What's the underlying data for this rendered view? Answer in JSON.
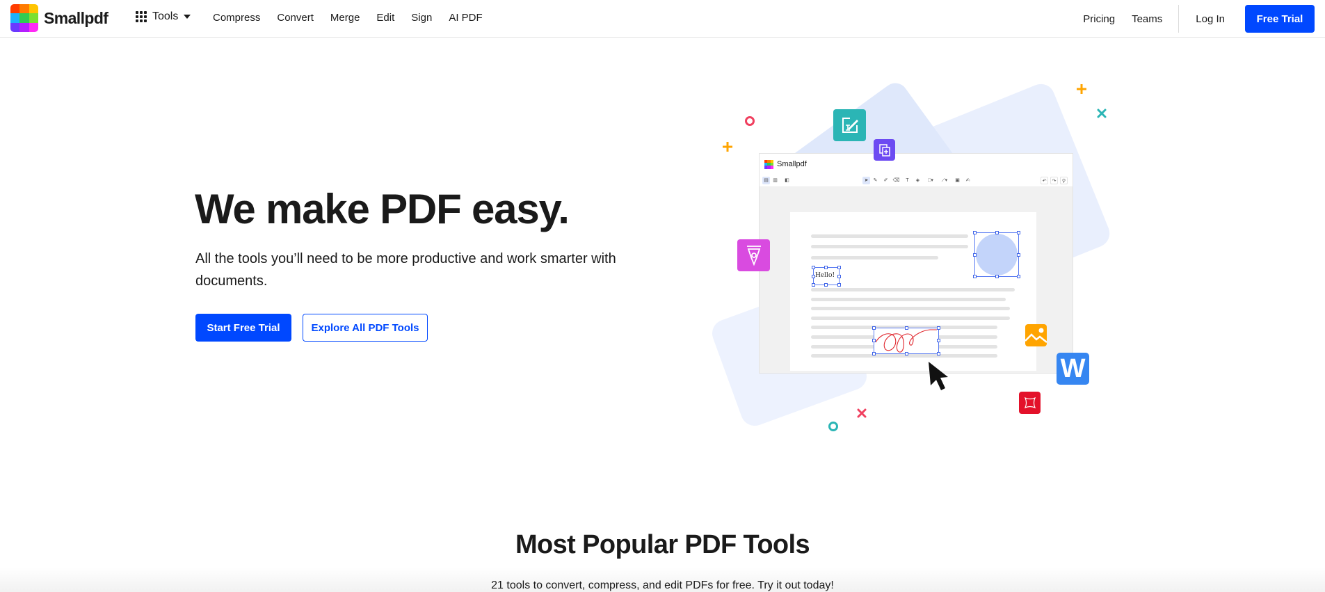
{
  "brand": {
    "name": "Smallpdf",
    "logo_colors": [
      "#ff3d00",
      "#ff7b00",
      "#ffc400",
      "#1eb1fc",
      "#2fcc52",
      "#7ae031",
      "#6b39ff",
      "#b51fff",
      "#ff2af5"
    ],
    "accent": "#0048ff"
  },
  "header": {
    "tools_label": "Tools",
    "nav": [
      {
        "label": "Compress"
      },
      {
        "label": "Convert"
      },
      {
        "label": "Merge"
      },
      {
        "label": "Edit"
      },
      {
        "label": "Sign"
      },
      {
        "label": "AI PDF"
      }
    ],
    "right_nav": [
      {
        "label": "Pricing"
      },
      {
        "label": "Teams"
      }
    ],
    "login_label": "Log In",
    "free_trial_label": "Free Trial"
  },
  "hero": {
    "title": "We make PDF easy.",
    "subtitle": "All the tools you’ll need to be more productive and work smarter with documents.",
    "primary_cta": "Start Free Trial",
    "secondary_cta": "Explore All PDF Tools"
  },
  "illustration": {
    "app_title": "Smallpdf",
    "text_annotation": "Hello!",
    "icons": [
      "edit-text-icon",
      "merge-pages-icon",
      "pen-nib-icon",
      "image-icon",
      "word-icon",
      "crop-icon",
      "cursor-icon"
    ],
    "word_letter": "W",
    "colors": {
      "teal": "#2bb5b5",
      "purple": "#6c4bf2",
      "magenta": "#d94be0",
      "orange": "#ffa400",
      "word_blue": "#3686f1",
      "red": "#e3112a",
      "selection_blue": "#3e63e8",
      "shape_fill": "#c3d4fa",
      "signature_red": "#e0262d"
    }
  },
  "section": {
    "title": "Most Popular PDF Tools",
    "subtitle": "21 tools to convert, compress, and edit PDFs for free. Try it out today!"
  }
}
